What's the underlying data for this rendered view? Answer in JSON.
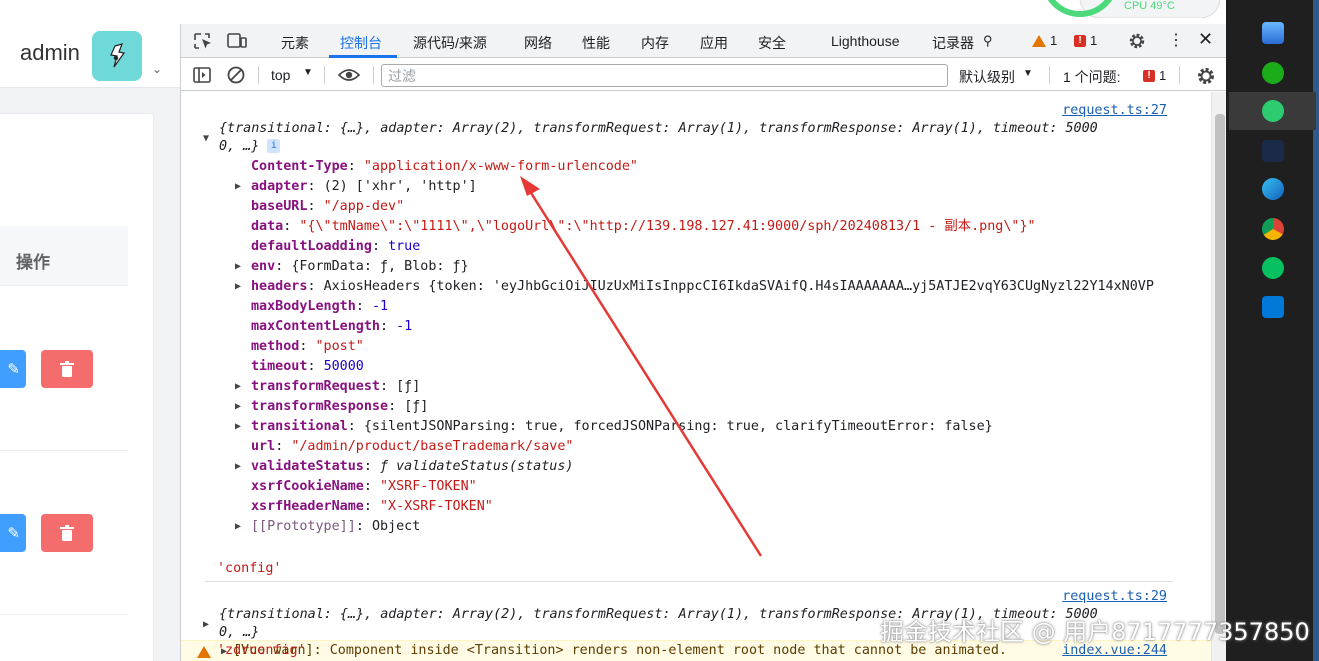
{
  "app": {
    "user_name": "admin",
    "table_header_action": "操作"
  },
  "devtools": {
    "tabs": [
      "元素",
      "控制台",
      "源代码/来源",
      "网络",
      "性能",
      "内存",
      "应用",
      "安全",
      "Lighthouse",
      "记录器"
    ],
    "active_tab": "控制台",
    "warnings_count": "1",
    "errors_count": "1",
    "context": "top",
    "filter_placeholder": "过滤",
    "levels_label": "默认级别",
    "issues_label": "1 个问题:",
    "issues_count": "1"
  },
  "console": {
    "msg1": {
      "source": "request.ts:27",
      "summary_l1": "{transitional: {…}, adapter: Array(2), transformRequest: Array(1), transformResponse: Array(1), timeout: 5000",
      "summary_l2": "0, …}",
      "props": [
        {
          "key": "Content-Type",
          "value": "\"application/x-www-form-urlencode\""
        },
        {
          "key": "adapter",
          "value": "(2) ['xhr', 'http']"
        },
        {
          "key": "baseURL",
          "value": "\"/app-dev\""
        },
        {
          "key": "data",
          "value": "\"{\\\"tmName\\\":\\\"1111\\\",\\\"logoUrl\\\":\\\"http://139.198.127.41:9000/sph/20240813/1 - 副本.png\\\"}\""
        },
        {
          "key": "defaultLoadding",
          "value": "true"
        },
        {
          "key": "env",
          "value": "{FormData: ƒ, Blob: ƒ}"
        },
        {
          "key": "headers",
          "value": "AxiosHeaders {token: 'eyJhbGciOiJIUzUxMiIsInppcCI6IkdaSVAifQ.H4sIAAAAAAA…yj5ATJE2vqY63CUgNyzl22Y14xN0VP"
        },
        {
          "key": "maxBodyLength",
          "value": "-1"
        },
        {
          "key": "maxContentLength",
          "value": "-1"
        },
        {
          "key": "method",
          "value": "\"post\""
        },
        {
          "key": "timeout",
          "value": "50000"
        },
        {
          "key": "transformRequest",
          "value": "[ƒ]"
        },
        {
          "key": "transformResponse",
          "value": "[ƒ]"
        },
        {
          "key": "transitional",
          "value": "{silentJSONParsing: true, forcedJSONParsing: true, clarifyTimeoutError: false}"
        },
        {
          "key": "url",
          "value": "\"/admin/product/baseTrademark/save\""
        },
        {
          "key": "validateStatus",
          "value": "ƒ validateStatus(status)"
        },
        {
          "key": "xsrfCookieName",
          "value": "\"XSRF-TOKEN\""
        },
        {
          "key": "xsrfHeaderName",
          "value": "\"X-XSRF-TOKEN\""
        },
        {
          "key": "[[Prototype]]",
          "value": "Object"
        }
      ],
      "label": "'config'"
    },
    "msg2": {
      "source": "request.ts:29",
      "summary_l1": "{transitional: {…}, adapter: Array(2), transformRequest: Array(1), transformResponse: Array(1), timeout: 5000",
      "summary_l2": "0, …}",
      "label": "'zdrconfig'"
    },
    "vue_warn": {
      "text": "[Vue warn]: Component inside <Transition> renders non-element root node that cannot be animated.",
      "source": "index.vue:244"
    }
  },
  "system": {
    "cpu_label": "CPU 49°C"
  },
  "watermark": "掘金技术社区 @ 用户8717777357850",
  "colors": {
    "accent": "#1a73e8",
    "edit_button": "#409eff",
    "delete_button": "#f56c6c",
    "avatar_bg": "#6fd8d8",
    "annotation_arrow": "#e53935"
  }
}
